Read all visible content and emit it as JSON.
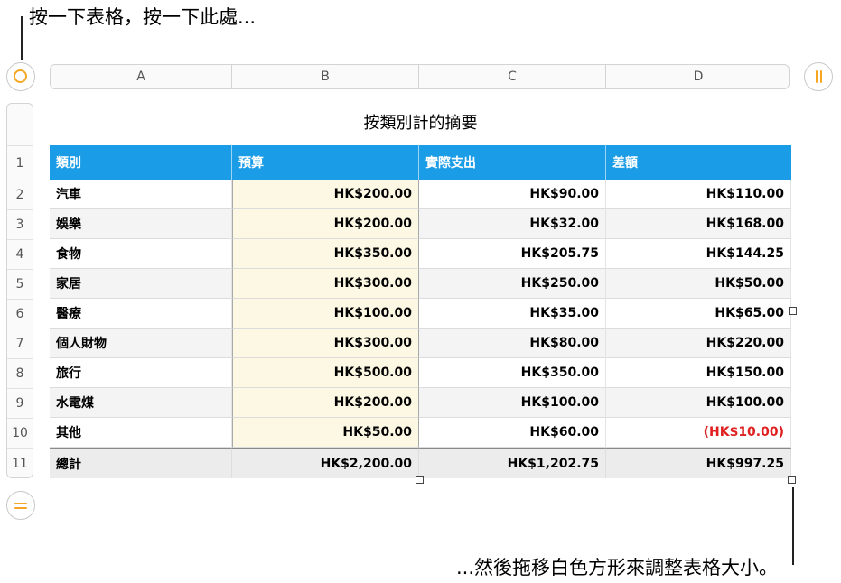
{
  "callouts": {
    "top": "按一下表格，按一下此處...",
    "bottom": "...然後拖移白色方形來調整表格大小。"
  },
  "column_header": [
    "A",
    "B",
    "C",
    "D"
  ],
  "row_header": [
    "1",
    "2",
    "3",
    "4",
    "5",
    "6",
    "7",
    "8",
    "9",
    "10",
    "11"
  ],
  "table": {
    "title": "按類別計的摘要",
    "headers": [
      "類別",
      "預算",
      "實際支出",
      "差額"
    ],
    "rows": [
      [
        "汽車",
        "HK$200.00",
        "HK$90.00",
        "HK$110.00"
      ],
      [
        "娛樂",
        "HK$200.00",
        "HK$32.00",
        "HK$168.00"
      ],
      [
        "食物",
        "HK$350.00",
        "HK$205.75",
        "HK$144.25"
      ],
      [
        "家居",
        "HK$300.00",
        "HK$250.00",
        "HK$50.00"
      ],
      [
        "醫療",
        "HK$100.00",
        "HK$35.00",
        "HK$65.00"
      ],
      [
        "個人財物",
        "HK$300.00",
        "HK$80.00",
        "HK$220.00"
      ],
      [
        "旅行",
        "HK$500.00",
        "HK$350.00",
        "HK$150.00"
      ],
      [
        "水電煤",
        "HK$200.00",
        "HK$100.00",
        "HK$100.00"
      ],
      [
        "其他",
        "HK$50.00",
        "HK$60.00",
        "(HK$10.00)"
      ]
    ],
    "footer": [
      "總計",
      "HK$2,200.00",
      "HK$1,202.75",
      "HK$997.25"
    ]
  },
  "icons": {
    "select_table": "circle-select-icon",
    "column_handle": "column-bars-icon",
    "row_handle": "row-bars-icon"
  },
  "colors": {
    "accent": "#f5a623",
    "header_fill": "#1b9ce6",
    "budget_column_fill": "#fcf8e3",
    "negative_text": "#e02020"
  }
}
